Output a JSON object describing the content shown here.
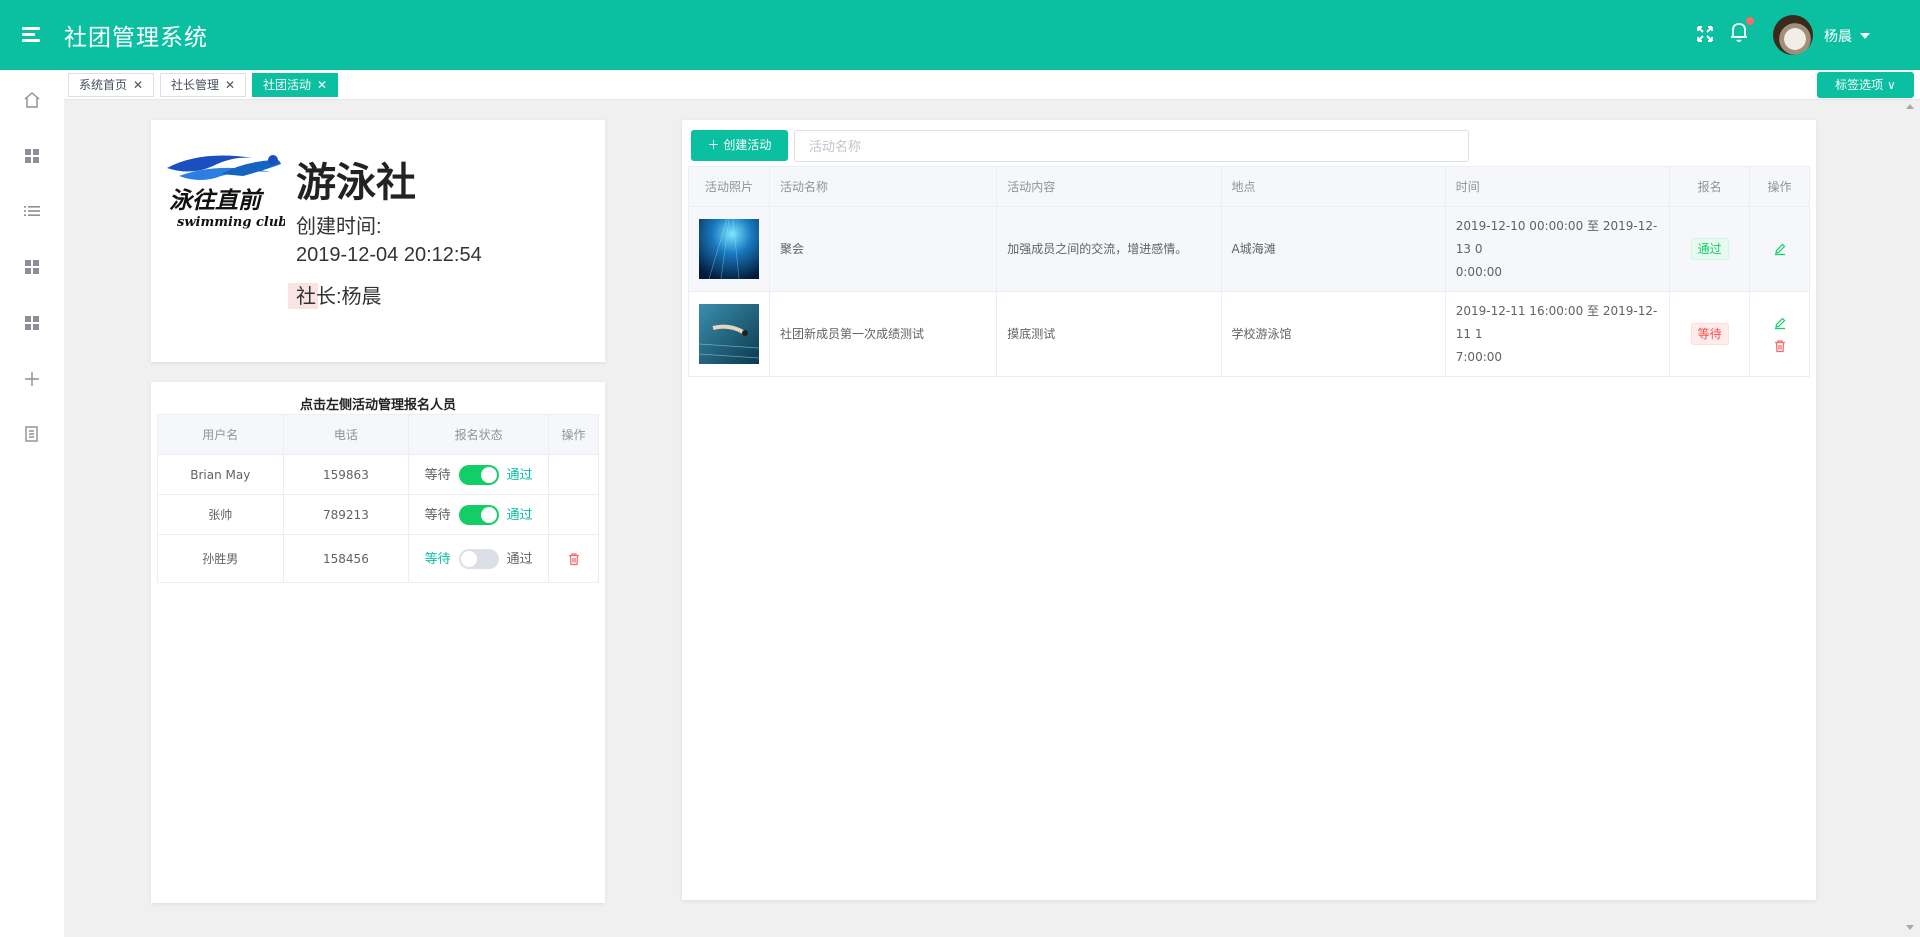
{
  "header": {
    "title": "社团管理系统",
    "username": "杨晨",
    "accent": "#0bbfa1"
  },
  "sidebar": {
    "icons": [
      "home-icon",
      "grid-icon",
      "list-icon",
      "grid-icon",
      "grid-icon",
      "plus-icon",
      "document-icon"
    ]
  },
  "tags": {
    "items": [
      {
        "label": "系统首页",
        "active": false
      },
      {
        "label": "社长管理",
        "active": false
      },
      {
        "label": "社团活动",
        "active": true
      }
    ],
    "options_label": "标签选项"
  },
  "club": {
    "logo_text": "泳往直前",
    "logo_subtext": "swimming club",
    "name": "游泳社",
    "created_label": "创建时间:",
    "created_time": "2019-12-04 20:12:54",
    "leader": "社长:杨晨"
  },
  "members": {
    "title": "点击左侧活动管理报名人员",
    "headers": [
      "用户名",
      "电话",
      "报名状态",
      "操作"
    ],
    "wait_label": "等待",
    "pass_label": "通过",
    "rows": [
      {
        "name": "Brian May",
        "phone": "159863",
        "approved": true
      },
      {
        "name": "张帅",
        "phone": "789213",
        "approved": true
      },
      {
        "name": "孙胜男",
        "phone": "158456",
        "approved": false
      }
    ]
  },
  "activities": {
    "create_label": "创建活动",
    "search_placeholder": "活动名称",
    "headers": [
      "活动照片",
      "活动名称",
      "活动内容",
      "地点",
      "时间",
      "报名",
      "操作"
    ],
    "rows": [
      {
        "name": "聚会",
        "content": "加强成员之间的交流，增进感情。",
        "place": "A城海滩",
        "time_line1": "2019-12-10 00:00:00 至 2019-12-13 0",
        "time_line2": "0:00:00",
        "status": "通过"
      },
      {
        "name": "社团新成员第一次成绩测试",
        "content": "摸底测试",
        "place": "学校游泳馆",
        "time_line1": "2019-12-11 16:00:00 至 2019-12-11 1",
        "time_line2": "7:00:00",
        "status": "等待"
      }
    ]
  }
}
